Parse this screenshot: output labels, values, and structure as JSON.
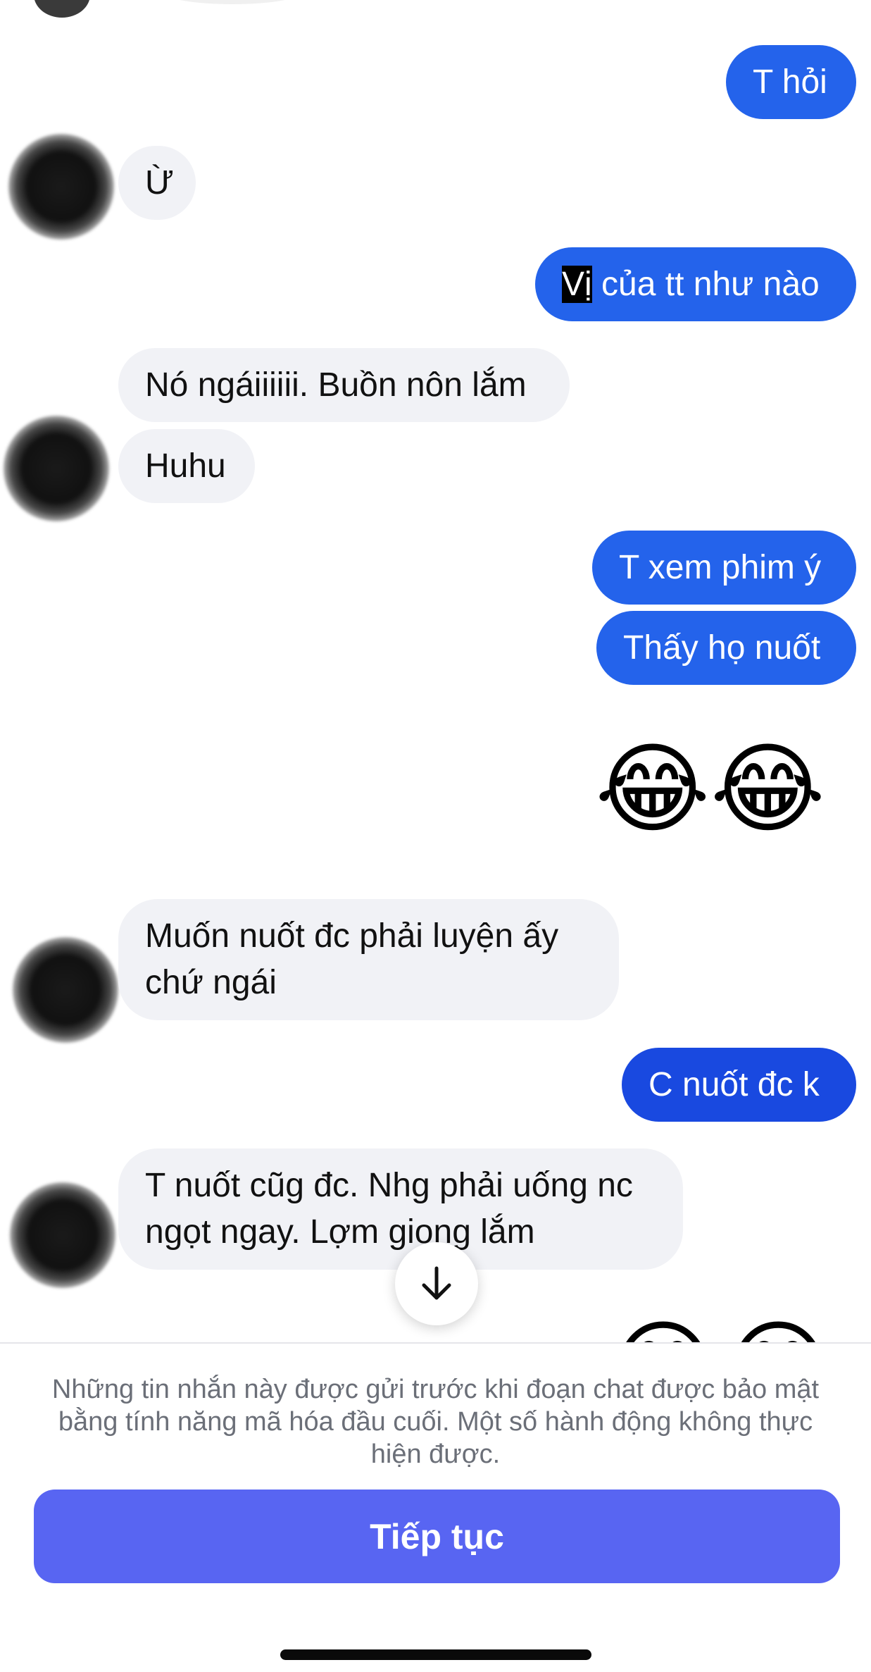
{
  "messages": {
    "m1": "T hỏi",
    "m2": "Ừ",
    "m3_highlight": "Vị",
    "m3_rest": " của tt như nào",
    "m4": "Nó ngáiiiiii. Buồn nôn lắm",
    "m5": "Huhu",
    "m6": "T xem phim ý",
    "m7": "Thấy họ nuốt",
    "m8": "😂😂",
    "m9": "Muốn nuốt đc phải luyện ấy chứ ngái",
    "m10": "C nuốt đc k",
    "m11": "T nuốt cũg đc. Nhg phải uống nc ngọt ngay. Lợm giọng lắm",
    "m12_partial": "😂😂"
  },
  "icons": {
    "scroll_down": "arrow-down-icon"
  },
  "footer": {
    "notice": "Những tin nhắn này được gửi trước khi đoạn chat được bảo mật bằng tính năng mã hóa đầu cuối. Một số hành động không thực hiện được.",
    "continue_label": "Tiếp tục"
  },
  "colors": {
    "outgoing_bubble": "#2463eb",
    "incoming_bubble": "#f1f2f6",
    "continue_button": "#5865f2"
  }
}
